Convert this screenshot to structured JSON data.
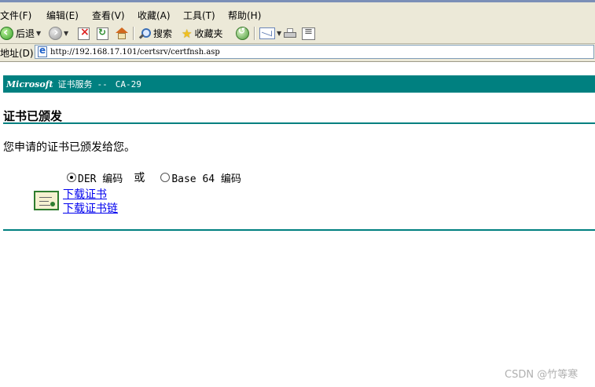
{
  "menu": [
    "文件(F)",
    "编辑(E)",
    "查看(V)",
    "收藏(A)",
    "工具(T)",
    "帮助(H)"
  ],
  "toolbar": {
    "back_label": "后退",
    "search_label": "搜索",
    "favorites_label": "收藏夹"
  },
  "address": {
    "label": "地址(D)",
    "url": "http://192.168.17.101/certsrv/certfnsh.asp"
  },
  "banner": {
    "brand": "Microsoft",
    "service": "证书服务",
    "separator": "--",
    "ca_name": "CA-29"
  },
  "content": {
    "heading": "证书已颁发",
    "message": "您申请的证书已颁发给您。",
    "encoding": {
      "der_label": "DER 编码",
      "or_label": "或",
      "base64_label": "Base 64 编码",
      "selected": "DER"
    },
    "download_cert_link": "下载证书",
    "download_chain_link": "下载证书链"
  },
  "watermark": "CSDN @竹等寒",
  "colors": {
    "accent": "#008080",
    "link": "#0000ee",
    "chrome": "#ece9d8"
  }
}
